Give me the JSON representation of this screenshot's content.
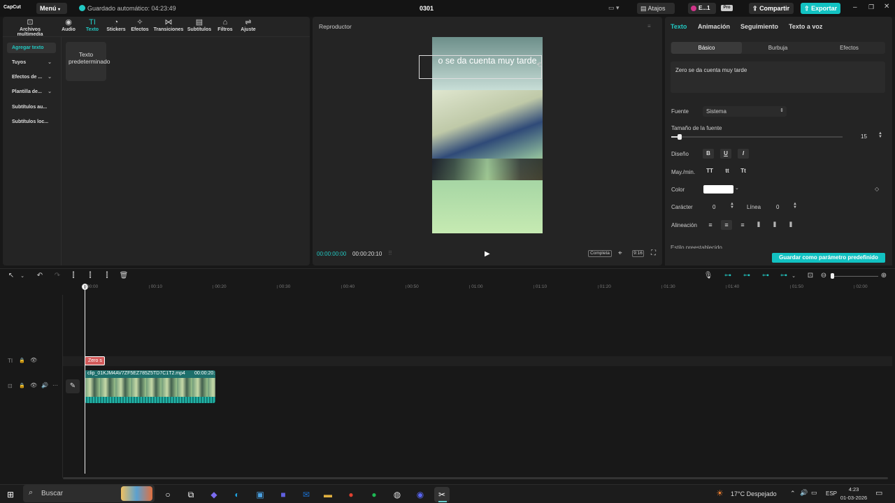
{
  "app": {
    "logo_text": "CapCut",
    "menu_label": "Menú",
    "autosave": "Guardado automático: 04:23:49",
    "project_title": "0301",
    "shortcuts_label": "Atajos",
    "user_label": "E...1",
    "pro_badge": "Pro",
    "share_label": "Compartir",
    "export_label": "Exportar"
  },
  "toolbar": {
    "items": [
      {
        "label": "Archivos multimedia",
        "icon": "media-icon"
      },
      {
        "label": "Audio",
        "icon": "audio-icon"
      },
      {
        "label": "Texto",
        "icon": "text-icon"
      },
      {
        "label": "Stickers",
        "icon": "sticker-icon"
      },
      {
        "label": "Efectos",
        "icon": "effects-icon"
      },
      {
        "label": "Transiciones",
        "icon": "transition-icon"
      },
      {
        "label": "Subtítulos",
        "icon": "subtitles-icon"
      },
      {
        "label": "Filtros",
        "icon": "filter-icon"
      },
      {
        "label": "Ajuste",
        "icon": "adjust-icon"
      }
    ],
    "active": "Texto"
  },
  "sidebar": {
    "items": [
      {
        "label": "Agregar texto"
      },
      {
        "label": "Tuyos"
      },
      {
        "label": "Efectos de ..."
      },
      {
        "label": "Plantilla de..."
      },
      {
        "label": "Subtítulos au..."
      },
      {
        "label": "Subtítulos loc..."
      }
    ]
  },
  "text_card": {
    "label": "Texto predeterminado"
  },
  "player": {
    "title": "Reproductor",
    "overlay_text": "o se da cuenta muy tarde",
    "time_current": "00:00:00:00",
    "time_total": "00:00:20:10",
    "full_label": "Completa",
    "ratio_label": "9:16"
  },
  "inspector": {
    "tabs": [
      "Texto",
      "Animación",
      "Seguimiento",
      "Texto a voz"
    ],
    "subtabs": [
      "Básico",
      "Burbuja",
      "Efectos"
    ],
    "text_value": "Zero se da cuenta muy tarde",
    "font_label": "Fuente",
    "font_value": "Sistema",
    "size_label": "Tamaño de la fuente",
    "size_value": "15",
    "size_level": 0.05,
    "design_label": "Diseño",
    "case_label": "May./min.",
    "case_buttons": [
      "TT",
      "tt",
      "Tt"
    ],
    "color_label": "Color",
    "color_value": "#ffffff",
    "char_label": "Carácter",
    "char_value": "0",
    "line_label": "Línea",
    "line_value": "0",
    "align_label": "Alineación",
    "preset_label": "Estilo preestablecido",
    "save_preset_label": "Guardar como parámetro predefinido"
  },
  "timeline": {
    "ticks": [
      "00:00",
      "00:10",
      "00:20",
      "00:30",
      "00:40",
      "00:50",
      "01:00",
      "01:10",
      "01:20",
      "01:30",
      "01:40",
      "01:50",
      "02:00"
    ],
    "text_clip": "Zero s",
    "video_clip_name": "clip_01KJM4AV7ZF5EZ785Z5TD7C1T2.mp4",
    "video_clip_duration": "00:00:20:"
  },
  "taskbar": {
    "search_placeholder": "Buscar",
    "weather": "17°C Despejado",
    "lang": "ESP",
    "time": "4:23",
    "date": "01-03-2026"
  },
  "colors": {
    "accent": "#22c9c3",
    "export": "#12c2c2",
    "text_clip": "#d25a5a",
    "video_clip": "#1e8a85"
  }
}
